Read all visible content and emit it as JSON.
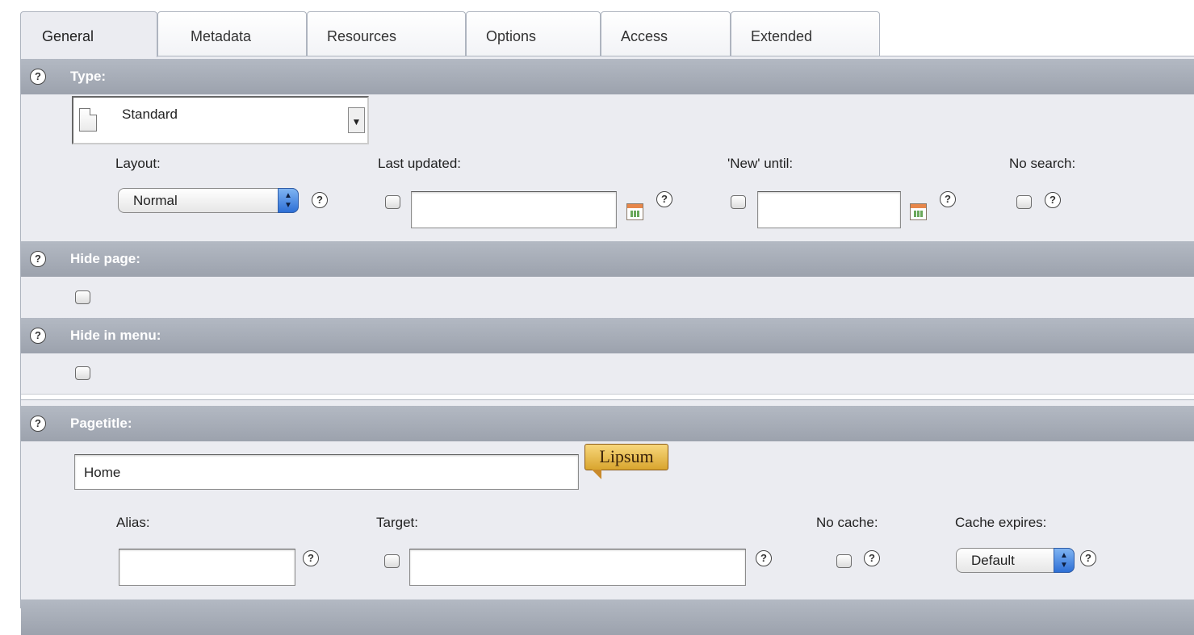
{
  "tabs": [
    "General",
    "Metadata",
    "Resources",
    "Options",
    "Access",
    "Extended"
  ],
  "sections": {
    "type": {
      "label": "Type:",
      "value": "Standard",
      "layout_label": "Layout:",
      "layout_value": "Normal",
      "last_updated_label": "Last updated:",
      "last_updated_value": "",
      "new_until_label": "'New' until:",
      "new_until_value": "",
      "no_search_label": "No search:"
    },
    "hide_page": {
      "label": "Hide page:"
    },
    "hide_in_menu": {
      "label": "Hide in menu:"
    },
    "pagetitle": {
      "label": "Pagetitle:",
      "value": "Home",
      "lipsum_label": "Lipsum",
      "alias_label": "Alias:",
      "alias_value": "",
      "target_label": "Target:",
      "target_value": "",
      "no_cache_label": "No cache:",
      "cache_expires_label": "Cache expires:",
      "cache_expires_value": "Default"
    }
  },
  "help_glyph": "?",
  "colors": {
    "bar": "#a9afba",
    "panel": "#ebecf1",
    "select_arrow": "#3a7ee0"
  }
}
